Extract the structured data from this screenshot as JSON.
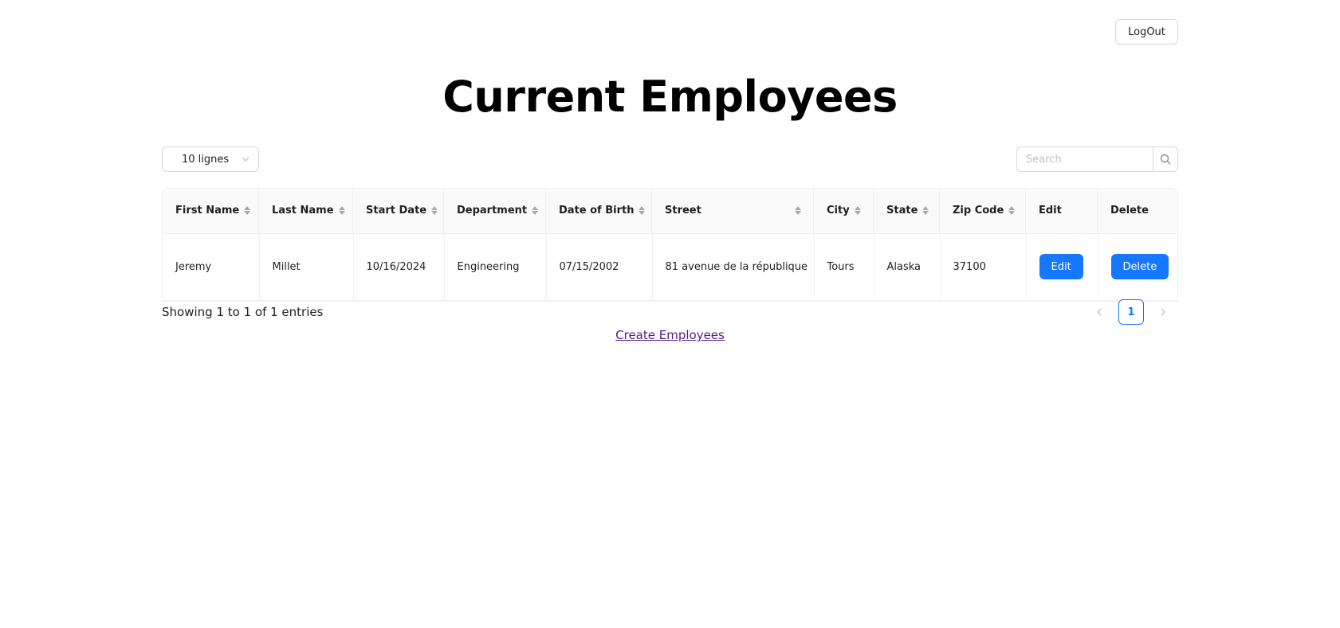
{
  "header": {
    "logout_label": "LogOut"
  },
  "page_title": "Current Employees",
  "controls": {
    "rows_per_page": "10 lignes",
    "search_placeholder": "Search"
  },
  "table": {
    "columns": [
      {
        "label": "First Name",
        "sortable": true
      },
      {
        "label": "Last Name",
        "sortable": true
      },
      {
        "label": "Start Date",
        "sortable": true
      },
      {
        "label": "Department",
        "sortable": true
      },
      {
        "label": "Date of Birth",
        "sortable": true
      },
      {
        "label": "Street",
        "sortable": true
      },
      {
        "label": "City",
        "sortable": true
      },
      {
        "label": "State",
        "sortable": true
      },
      {
        "label": "Zip Code",
        "sortable": true
      },
      {
        "label": "Edit",
        "sortable": false
      },
      {
        "label": "Delete",
        "sortable": false
      }
    ],
    "rows": [
      {
        "first_name": "Jeremy",
        "last_name": "Millet",
        "start_date": "10/16/2024",
        "department": "Engineering",
        "date_of_birth": "07/15/2002",
        "street": "81 avenue de la république",
        "city": "Tours",
        "state": "Alaska",
        "zip_code": "37100",
        "edit_label": "Edit",
        "delete_label": "Delete"
      }
    ]
  },
  "footer": {
    "showing_text": "Showing 1 to 1 of 1 entries",
    "current_page": "1",
    "create_link": "Create Employees"
  },
  "colors": {
    "primary": "#1677ff",
    "link_visited": "#551a8b",
    "header_bg": "#fafafa",
    "border": "#f0f0f0"
  }
}
